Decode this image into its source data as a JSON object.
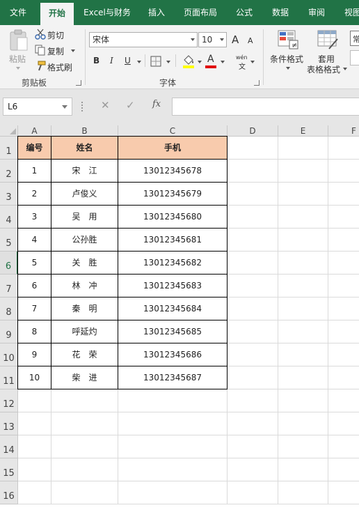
{
  "ribbon_tabs": [
    {
      "label": "文件",
      "active": false
    },
    {
      "label": "开始",
      "active": true
    },
    {
      "label": "Excel与财务",
      "active": false
    },
    {
      "label": "插入",
      "active": false
    },
    {
      "label": "页面布局",
      "active": false
    },
    {
      "label": "公式",
      "active": false
    },
    {
      "label": "数据",
      "active": false
    },
    {
      "label": "审阅",
      "active": false
    },
    {
      "label": "视图",
      "active": false
    }
  ],
  "clipboard": {
    "paste": "粘贴",
    "cut": "剪切",
    "copy": "复制",
    "format_painter": "格式刷",
    "group": "剪贴板"
  },
  "font": {
    "name": "宋体",
    "size": "10",
    "grow": "A",
    "shrink": "A",
    "bold": "B",
    "italic": "I",
    "underline": "U",
    "font_color_glyph": "A",
    "phonetic_top": "wén",
    "phonetic_bottom": "文",
    "group": "字体"
  },
  "styles": {
    "conditional": "条件格式",
    "table_format_1": "套用",
    "table_format_2": "表格格式",
    "partial": "常"
  },
  "formula_bar": {
    "name_box": "L6",
    "cancel": "✕",
    "enter": "✓",
    "fx": "fx",
    "formula": ""
  },
  "columns": [
    "A",
    "B",
    "C",
    "D",
    "E",
    "F"
  ],
  "rows": [
    "1",
    "2",
    "3",
    "4",
    "5",
    "6",
    "7",
    "8",
    "9",
    "10",
    "11",
    "12",
    "13",
    "14",
    "15",
    "16"
  ],
  "selected_row": "6",
  "table": {
    "headers": [
      "编号",
      "姓名",
      "手机"
    ],
    "rows": [
      [
        "1",
        "宋　江",
        "13012345678"
      ],
      [
        "2",
        "卢俊义",
        "13012345679"
      ],
      [
        "3",
        "吴　用",
        "13012345680"
      ],
      [
        "4",
        "公孙胜",
        "13012345681"
      ],
      [
        "5",
        "关　胜",
        "13012345682"
      ],
      [
        "6",
        "林　冲",
        "13012345683"
      ],
      [
        "7",
        "秦　明",
        "13012345684"
      ],
      [
        "8",
        "呼延灼",
        "13012345685"
      ],
      [
        "9",
        "花　荣",
        "13012345686"
      ],
      [
        "10",
        "柴　进",
        "13012345687"
      ]
    ]
  },
  "colors": {
    "ribbon_green": "#217346",
    "header_fill": "#f8cbad",
    "font_color_bar": "#e00000",
    "fill_color_bar": "#ffff00"
  }
}
